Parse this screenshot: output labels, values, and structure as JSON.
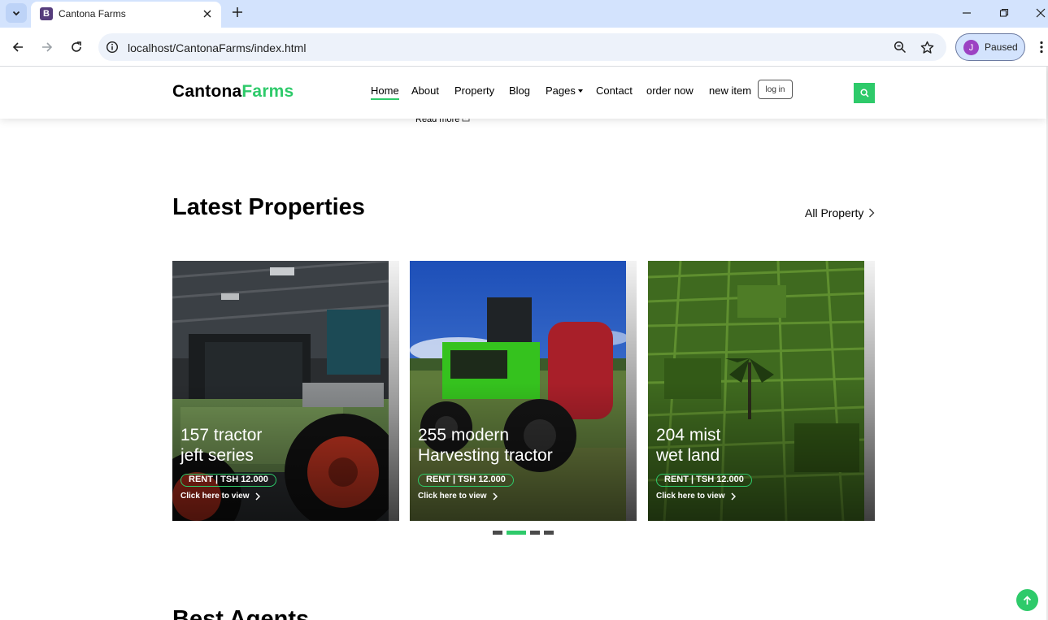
{
  "browser": {
    "tab_title": "Cantona Farms",
    "tab_favicon": "B",
    "url": "localhost/CantonaFarms/index.html",
    "profile_initial": "J",
    "profile_label": "Paused",
    "icons": [
      "tab-list-icon",
      "close-icon",
      "new-tab-icon",
      "minimize-icon",
      "restore-icon",
      "window-close-icon",
      "back-icon",
      "forward-icon",
      "reload-icon",
      "info-icon",
      "zoom-icon",
      "bookmark-star-icon",
      "more-icon"
    ]
  },
  "site": {
    "brand_part1": "Cantona",
    "brand_part2": "Farms",
    "accent_color": "#2eca6a",
    "nav": {
      "home": "Home",
      "about": "About",
      "property": "Property",
      "blog": "Blog",
      "pages": "Pages",
      "contact": "Contact",
      "order": "order now",
      "new_item": "new item",
      "login": "log in"
    },
    "read_more": "Read more"
  },
  "properties_section": {
    "title": "Latest Properties",
    "all_link": "All Property",
    "cards": [
      {
        "line1": "157 tractor",
        "line2": "jeft series",
        "badge": "RENT | TSH 12.000",
        "link": "Click here to view"
      },
      {
        "line1": "255 modern",
        "line2": "Harvesting tractor",
        "badge": "RENT | TSH 12.000",
        "link": "Click here to view"
      },
      {
        "line1": "204 mist",
        "line2": "wet land",
        "badge": "RENT | TSH 12.000",
        "link": "Click here to view"
      }
    ],
    "carousel_pages": 4,
    "carousel_active_index": 1
  },
  "agents_section": {
    "title": "Best Agents"
  }
}
